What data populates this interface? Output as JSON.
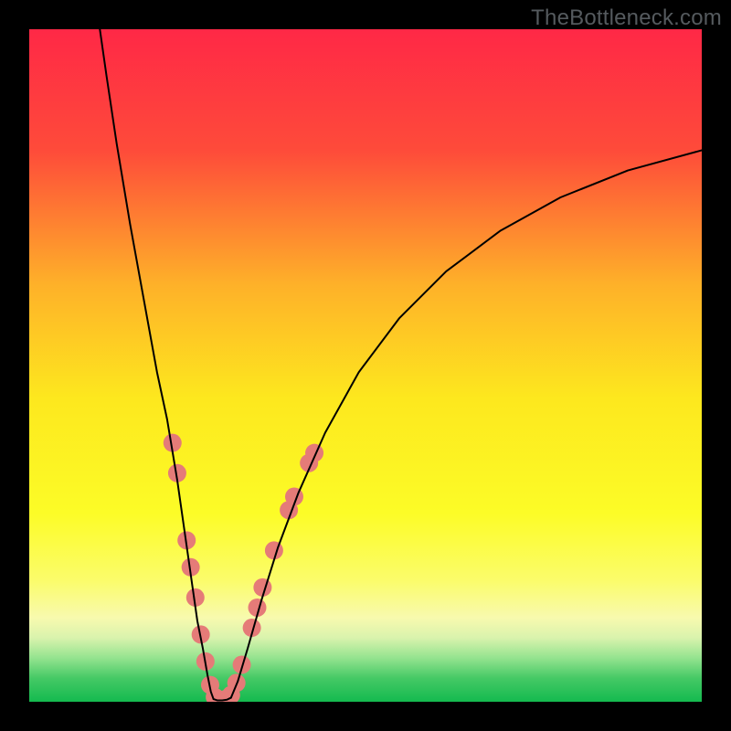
{
  "watermark": {
    "text": "TheBottleneck.com"
  },
  "chart_data": {
    "type": "line",
    "title": "",
    "xlabel": "",
    "ylabel": "",
    "xlim": [
      0,
      100
    ],
    "ylim": [
      0,
      100
    ],
    "grid": false,
    "legend": false,
    "background_gradient": {
      "stops": [
        {
          "offset": 0.0,
          "color": "#ff2846"
        },
        {
          "offset": 0.18,
          "color": "#fe4b3a"
        },
        {
          "offset": 0.38,
          "color": "#feb129"
        },
        {
          "offset": 0.55,
          "color": "#fde81e"
        },
        {
          "offset": 0.72,
          "color": "#fcfc27"
        },
        {
          "offset": 0.82,
          "color": "#fbfc6b"
        },
        {
          "offset": 0.875,
          "color": "#f8faae"
        },
        {
          "offset": 0.905,
          "color": "#d9f3ad"
        },
        {
          "offset": 0.935,
          "color": "#94e38f"
        },
        {
          "offset": 0.965,
          "color": "#45c965"
        },
        {
          "offset": 1.0,
          "color": "#14ba4f"
        }
      ]
    },
    "series": [
      {
        "name": "left-branch",
        "color": "#000000",
        "x": [
          10.5,
          11.5,
          13.0,
          15.0,
          17.0,
          19.0,
          20.5,
          22.0,
          23.0,
          24.0,
          25.0,
          25.8,
          26.5,
          27.0,
          27.4
        ],
        "y": [
          100,
          93,
          83,
          71,
          60,
          49,
          42,
          33,
          26,
          19,
          12,
          8,
          4,
          1.5,
          0.4
        ]
      },
      {
        "name": "valley-floor",
        "color": "#000000",
        "x": [
          27.4,
          28.0,
          28.7,
          29.4,
          30.0
        ],
        "y": [
          0.4,
          0.2,
          0.2,
          0.3,
          0.6
        ]
      },
      {
        "name": "right-branch",
        "color": "#000000",
        "x": [
          30.0,
          31.0,
          32.5,
          34.5,
          37.0,
          40.0,
          44.0,
          49.0,
          55.0,
          62.0,
          70.0,
          79.0,
          89.0,
          100.0
        ],
        "y": [
          0.6,
          3,
          8,
          15,
          23,
          31,
          40,
          49,
          57,
          64,
          70,
          75,
          79,
          82
        ]
      }
    ],
    "markers": {
      "name": "highlight-dots",
      "color": "#e57b78",
      "radius": 10,
      "points": [
        {
          "x": 21.3,
          "y": 38.5
        },
        {
          "x": 22.0,
          "y": 34.0
        },
        {
          "x": 23.4,
          "y": 24.0
        },
        {
          "x": 24.0,
          "y": 20.0
        },
        {
          "x": 24.7,
          "y": 15.5
        },
        {
          "x": 25.5,
          "y": 10.0
        },
        {
          "x": 26.2,
          "y": 6.0
        },
        {
          "x": 26.9,
          "y": 2.5
        },
        {
          "x": 27.6,
          "y": 0.7
        },
        {
          "x": 28.4,
          "y": 0.3
        },
        {
          "x": 29.2,
          "y": 0.4
        },
        {
          "x": 30.0,
          "y": 1.0
        },
        {
          "x": 30.8,
          "y": 2.8
        },
        {
          "x": 31.6,
          "y": 5.5
        },
        {
          "x": 33.1,
          "y": 11.0
        },
        {
          "x": 33.9,
          "y": 14.0
        },
        {
          "x": 34.7,
          "y": 17.0
        },
        {
          "x": 36.4,
          "y": 22.5
        },
        {
          "x": 38.6,
          "y": 28.5
        },
        {
          "x": 39.4,
          "y": 30.5
        },
        {
          "x": 41.6,
          "y": 35.5
        },
        {
          "x": 42.4,
          "y": 37.0
        }
      ]
    }
  }
}
